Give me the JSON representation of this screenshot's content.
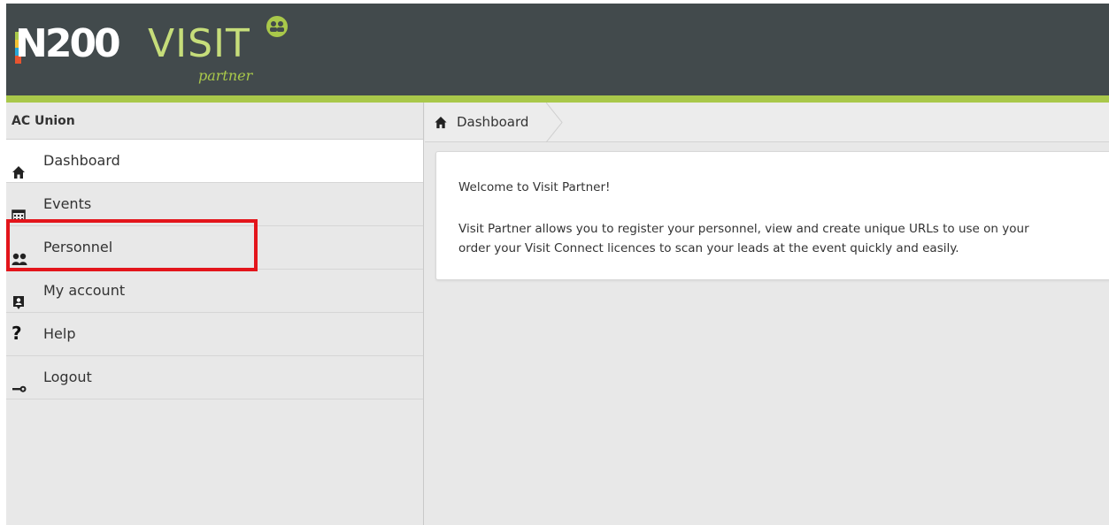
{
  "brand": {
    "logo_main": "N200",
    "logo_product": "VISIT",
    "logo_sub": "partner",
    "colors": {
      "header": "#424a4c",
      "accent": "#a9c84a",
      "highlight": "#e3151b"
    }
  },
  "sidebar": {
    "title": "AC Union",
    "items": [
      {
        "label": "Dashboard",
        "icon": "home-icon",
        "active": true
      },
      {
        "label": "Events",
        "icon": "calendar-icon",
        "active": false
      },
      {
        "label": "Personnel",
        "icon": "users-icon",
        "active": false
      },
      {
        "label": "My account",
        "icon": "account-badge-icon",
        "active": false
      },
      {
        "label": "Help",
        "icon": "question-icon",
        "active": false
      },
      {
        "label": "Logout",
        "icon": "key-icon",
        "active": false
      }
    ]
  },
  "breadcrumb": {
    "label": "Dashboard",
    "icon": "home-icon"
  },
  "welcome": {
    "title": "Welcome to Visit Partner!",
    "line1": "Visit Partner allows you to register your personnel, view and create unique URLs to use on your",
    "line2": "order your Visit Connect licences to scan your leads at the event quickly and easily."
  }
}
